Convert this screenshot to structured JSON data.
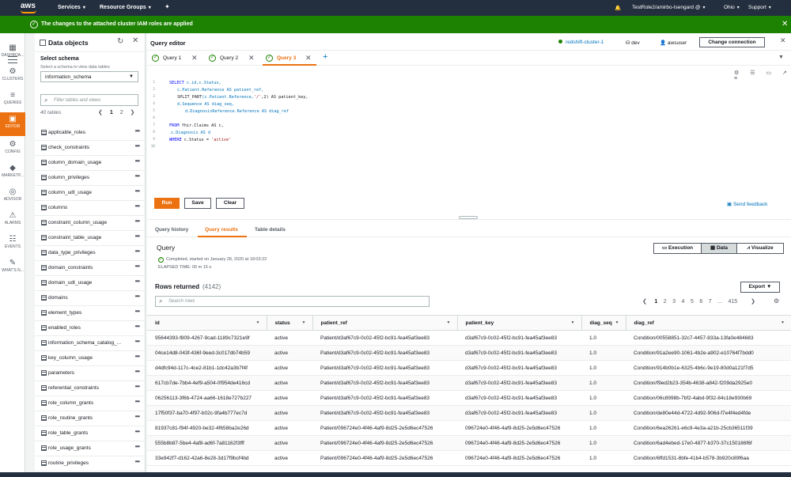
{
  "topnav": {
    "logo": "aws",
    "services": "Services",
    "resource_groups": "Resource Groups",
    "account": "TestRole2/amirbo-Isengard @",
    "region": "Ohio",
    "support": "Support"
  },
  "flash": {
    "message": "The changes to the attached cluster IAM roles are applied"
  },
  "rail": [
    {
      "label": "DASHBOA...",
      "icon": "dashboard-icon"
    },
    {
      "label": "CLUSTERS",
      "icon": "clusters-icon"
    },
    {
      "label": "QUERIES",
      "icon": "queries-icon"
    },
    {
      "label": "EDITOR",
      "icon": "editor-icon",
      "active": true
    },
    {
      "label": "CONFIG",
      "icon": "config-icon"
    },
    {
      "label": "MARKETP...",
      "icon": "marketplace-icon"
    },
    {
      "label": "ADVISOR",
      "icon": "advisor-icon"
    },
    {
      "label": "ALARMS",
      "icon": "alarms-icon"
    },
    {
      "label": "EVENTS",
      "icon": "events-icon"
    },
    {
      "label": "WHAT'S N...",
      "icon": "whats-new-icon"
    }
  ],
  "objects": {
    "title": "Data objects",
    "schema_label": "Select schema",
    "schema_help": "Select a schema to view data tables",
    "schema_value": "information_schema",
    "filter_placeholder": "Filter tables and views",
    "count": "40 tables",
    "pages": [
      "1",
      "2"
    ],
    "tables": [
      "applicable_roles",
      "check_constraints",
      "column_domain_usage",
      "column_privileges",
      "column_udt_usage",
      "columns",
      "constraint_column_usage",
      "constraint_table_usage",
      "data_type_privileges",
      "domain_constraints",
      "domain_udt_usage",
      "domains",
      "element_types",
      "enabled_roles",
      "information_schema_catalog_...",
      "key_column_usage",
      "parameters",
      "referential_constraints",
      "role_column_grants",
      "role_routine_grants",
      "role_table_grants",
      "role_usage_grants",
      "routine_privileges"
    ]
  },
  "editor": {
    "title": "Query editor",
    "cluster": "redshift-cluster-1",
    "database": "dev",
    "user": "awsuser",
    "change_connection": "Change connection",
    "tabs": [
      "Query 1",
      "Query 2",
      "Query 3"
    ],
    "sql": {
      "l1a": "SELECT",
      "l1b": " c.id,c.Status,",
      "l2": "c.Patient.Reference AS patient_ref,",
      "l3a": "SPLIT_PART",
      "l3b": "(c.Patient.Reference,",
      "l3c": "'/'",
      "l3d": ",2) AS patient_key,",
      "l4": "d.Sequence AS diag_seq,",
      "l5": "d.DiagnosisReference.Reference AS diag_ref",
      "l7a": "FROM",
      "l7b": " fhir.Claims AS c,",
      "l8": "c.Diagnosis AS d",
      "l9a": "WHERE",
      "l9b": " c.Status = ",
      "l9c": "'active'"
    },
    "run": "Run",
    "save": "Save",
    "clear": "Clear",
    "feedback": "Send feedback"
  },
  "results": {
    "tabs": [
      "Query history",
      "Query results",
      "Table details"
    ],
    "query_title": "Query",
    "completed": "Completed, started on January 28, 2020 at 18:03:22",
    "elapsed": "ELAPSED TIME: 00 m 15 s",
    "views": [
      "Execution",
      "Data",
      "Visualize"
    ],
    "rows_returned": "Rows returned",
    "rows_count": "(4142)",
    "export": "Export",
    "search_placeholder": "Search rows",
    "pages": [
      "1",
      "2",
      "3",
      "4",
      "5",
      "6",
      "7",
      "...",
      "415"
    ],
    "columns": [
      "id",
      "status",
      "patient_ref",
      "patient_key",
      "diag_seq",
      "diag_ref"
    ],
    "rows": [
      [
        "95644393-f809-4267-9cad-1189c7321e9f",
        "active",
        "Patient/d3af67c9-0c02-45f2-bc91-fea45af3ee83",
        "d3af67c9-0c02-45f2-bc91-fea45af3ee83",
        "1.0",
        "Condition/00558851-32c7-4457-833a-13fa0e484683"
      ],
      [
        "04ce14d8-043f-436f-9eed-3c017db74b59",
        "active",
        "Patient/d3af67c9-0c02-45f2-bc91-fea45af3ee83",
        "d3af67c9-0c02-45f2-bc91-fea45af3ee83",
        "1.0",
        "Condition/91a2ee90-1061-4b2e-a902-e10764f7bdd0"
      ],
      [
        "d4dfc94d-117c-4ce2-81b1-1dc42a3b7f4f",
        "active",
        "Patient/d3af67c9-0c02-45f2-bc91-fea45af3ee83",
        "d3af67c9-0c02-45f2-bc91-fea45af3ee83",
        "1.0",
        "Condition/914b0b1e-6325-4b6c-9e19-80d0a121f7d5"
      ],
      [
        "617cb7de-7bb4-4ef9-a504-0f954de416cd",
        "active",
        "Patient/d3af67c9-0c02-45f2-bc91-fea45af3ee83",
        "d3af67c9-0c02-45f2-bc91-fea45af3ee83",
        "1.0",
        "Condition/f9ed2b23-354b-4638-a842-f209da2925e0"
      ],
      [
        "06256113-3f6b-4724-aa66-1618e727b227",
        "active",
        "Patient/d3af67c9-0c02-45f2-bc91-fea45af3ee83",
        "d3af67c9-0c02-45f2-bc91-fea45af3ee83",
        "1.0",
        "Condition/06c8998b-7bf2-4abd-9f32-84c18e930b69"
      ],
      [
        "17f50f37-ba70-4f97-b02c-9fa4b777ec7d",
        "active",
        "Patient/d3af67c9-0c02-45f2-bc91-fea45af3ee83",
        "d3af67c9-0c02-45f2-bc91-fea45af3ee83",
        "1.0",
        "Condition/de80e44d-4722-4d92-906d-f7e4f4ed4fde"
      ],
      [
        "81937c81-f94f-4920-be32-4f658ba2e26d",
        "active",
        "Patient/096724e0-4f46-4af9-8d25-2e5d6ec47526",
        "096724e0-4f46-4af9-8d25-2e5d6ec47526",
        "1.0",
        "Condition/6ea26261-e6c9-4e3a-a21b-25cb36511f39"
      ],
      [
        "555b8b87-5be4-4af8-ad6f-7a81162f3fff",
        "active",
        "Patient/096724e0-4f46-4af9-8d25-2e5d6ec47526",
        "096724e0-4f46-4af9-8d25-2e5d6ec47526",
        "1.0",
        "Condition/6ad4ebed-17e0-4877-b370-37c150186f6f"
      ],
      [
        "33e942f7-d162-42a6-8e28-3d17f9bcf4bd",
        "active",
        "Patient/096724e0-4f46-4af9-8d25-2e5d6ec47526",
        "096724e0-4f46-4af9-8d25-2e5d6ec47526",
        "1.0",
        "Condition/6ffd1531-8bfe-41b4-b578-3b920c89f6aa"
      ]
    ]
  }
}
